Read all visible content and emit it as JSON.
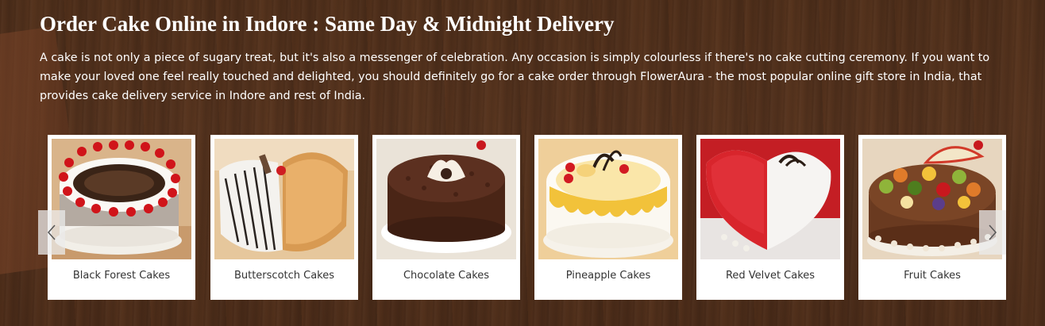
{
  "section": {
    "title": "Order Cake Online in Indore : Same Day & Midnight Delivery",
    "description": "A cake is not only a piece of sugary treat, but it's also a messenger of celebration. Any occasion is simply colourless if there's no cake cutting ceremony. If you want to make your loved one feel really touched and delighted, you should definitely go for a cake order through FlowerAura - the most popular online gift store in India, that provides cake delivery service in Indore and rest of India."
  },
  "carousel": {
    "prev_icon": "chevron-left-icon",
    "next_icon": "chevron-right-icon",
    "items": [
      {
        "label": "Black Forest Cakes"
      },
      {
        "label": "Butterscotch Cakes"
      },
      {
        "label": "Chocolate Cakes"
      },
      {
        "label": "Pineapple Cakes"
      },
      {
        "label": "Red Velvet Cakes"
      },
      {
        "label": "Fruit Cakes"
      }
    ]
  }
}
